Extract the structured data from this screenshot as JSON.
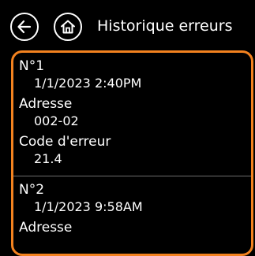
{
  "header": {
    "title": "Historique erreurs",
    "back_icon": "arrow-left-icon",
    "home_icon": "home-icon"
  },
  "colors": {
    "background": "#000000",
    "accent_border": "#f3821f",
    "separator": "#6e6e6e",
    "text": "#ffffff"
  },
  "entries": [
    {
      "number": "N°1",
      "datetime": "1/1/2023 2:40PM",
      "address_label": "Adresse",
      "address": "002-02",
      "code_label": "Code d'erreur",
      "code": "21.4"
    },
    {
      "number": "N°2",
      "datetime": "1/1/2023 9:58AM",
      "address_label": "Adresse"
    }
  ]
}
